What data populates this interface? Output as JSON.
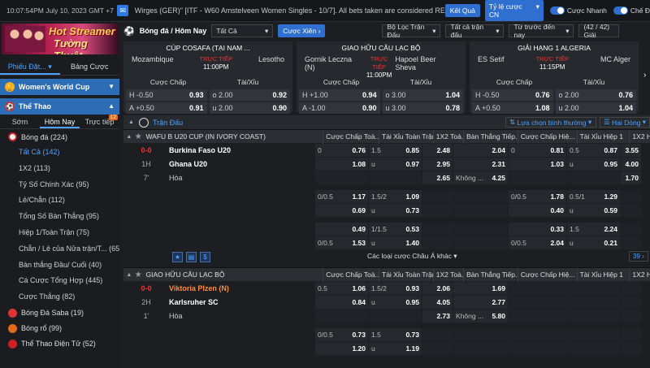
{
  "topbar": {
    "time": "10:07:54PM July 10, 2023 GMT +7",
    "marquee": "Wirges (GER)\" [ITF - W60 Amstelveen Women Singles - 10/7]. All bets taken are considered REFUNDED.",
    "result_btn": "Kết Quả",
    "odds_type": "Tỷ lệ cược CN",
    "fast_bet": "Cược Nhanh",
    "theme": "Chế Đ"
  },
  "sidebar": {
    "banner_line1": "Hot Streamer",
    "banner_line2": "Tường Thuật",
    "tab_bets": "Phiếu Đặt...",
    "tab_table": "Bảng Cược",
    "womens_cup": "Women's World Cup",
    "sports": "Thể Thao",
    "sub_early": "Sớm",
    "sub_today": "Hôm Nay",
    "sub_live": "Trực tiếp",
    "live_count": "12",
    "items": [
      {
        "label": "Bóng đá (224)"
      },
      {
        "label": "Tất Cả (142)"
      },
      {
        "label": "1X2 (113)"
      },
      {
        "label": "Tỷ Số Chính Xác (95)"
      },
      {
        "label": "Lẻ/Chẵn (112)"
      },
      {
        "label": "Tổng Số Bàn Thắng (95)"
      },
      {
        "label": "Hiệp 1/Toàn Trận (75)"
      },
      {
        "label": "Chẵn / Lẻ của Nửa trận/T... (65)"
      },
      {
        "label": "Bàn thắng Đầu/ Cuối (40)"
      },
      {
        "label": "Cá Cược Tổng Hợp (445)"
      },
      {
        "label": "Cược Thắng (82)"
      },
      {
        "label": "Bóng Đá Saba (19)"
      },
      {
        "label": "Bóng rổ (99)"
      },
      {
        "label": "Thể Thao Điện Tử (52)"
      }
    ]
  },
  "main": {
    "title": "Bóng đá / Hôm Nay",
    "filter_all": "Tất Cả",
    "parlay_btn": "Cược Xiên",
    "league_filter": "Bộ Lọc Trận Đấu",
    "all_matches": "Tất cả trận đấu",
    "sort_time": "Từ trước đến nay",
    "count": "(42 / 42) Giải",
    "cards": [
      {
        "league": "CÚP COSAFA (TẠI NAM ...",
        "home": "Mozambique",
        "away": "Lesotho",
        "status": "TRỰC TIẾP",
        "time": "11:00PM",
        "hdp_label": "Cược Chấp",
        "ou_label": "Tài/Xỉu",
        "r1": {
          "h": "H -0.50",
          "hv": "0.93",
          "o": "o 2.00",
          "ov": "0.92"
        },
        "r2": {
          "h": "A +0.50",
          "hv": "0.91",
          "o": "u 2.00",
          "ov": "0.90"
        }
      },
      {
        "league": "GIAO HỮU CÂU LẠC BỘ",
        "home": "Gornik Leczna (N)",
        "away": "Hapoel Beer Sheva",
        "status": "TRỰC TIẾP",
        "time": "11:00PM",
        "hdp_label": "Cược Chấp",
        "ou_label": "Tài/Xỉu",
        "r1": {
          "h": "H +1.00",
          "hv": "0.94",
          "o": "o 3.00",
          "ov": "1.04"
        },
        "r2": {
          "h": "A -1.00",
          "hv": "0.90",
          "o": "u 3.00",
          "ov": "0.78"
        }
      },
      {
        "league": "GIẢI HẠNG 1 ALGERIA",
        "home": "ES Setif",
        "away": "MC Alger",
        "status": "TRỰC TIẾP",
        "time": "11:15PM",
        "hdp_label": "Cược Chấp",
        "ou_label": "Tài/Xỉu",
        "r1": {
          "h": "H -0.50",
          "hv": "0.76",
          "o": "o 2.00",
          "ov": "0.76"
        },
        "r2": {
          "h": "A +0.50",
          "hv": "1.08",
          "o": "u 2.00",
          "ov": "1.04"
        }
      }
    ],
    "match_head": "Trận Đấu",
    "sort_normal": "Lựa chọn bình thường",
    "odds_format": "Hai Dòng",
    "cols": [
      "Cược Chấp Toà...",
      "Tài Xỉu Toàn Trận",
      "1X2 Toà...",
      "Bàn Thắng Tiếp...",
      "Cược Chấp Hiệ...",
      "Tài Xỉu Hiệp 1",
      "1X2 Hiệ"
    ],
    "league1": "WAFU B U20 CUP (IN IVORY COAST)",
    "league2": "GIAO HỮU CÂU LẠC BỘ",
    "match1": {
      "score": "0-0",
      "half": "1H",
      "min": "7'",
      "home": "Burkina Faso U20",
      "away": "Ghana U20",
      "draw": "Hòa"
    },
    "match2": {
      "score": "0-0",
      "half": "2H",
      "min": "1'",
      "home": "Viktoria Plzen (N)",
      "away": "Karlsruher SC",
      "draw": "Hòa"
    },
    "more_types": "Các loại cược Châu Á khác",
    "page": "39"
  }
}
